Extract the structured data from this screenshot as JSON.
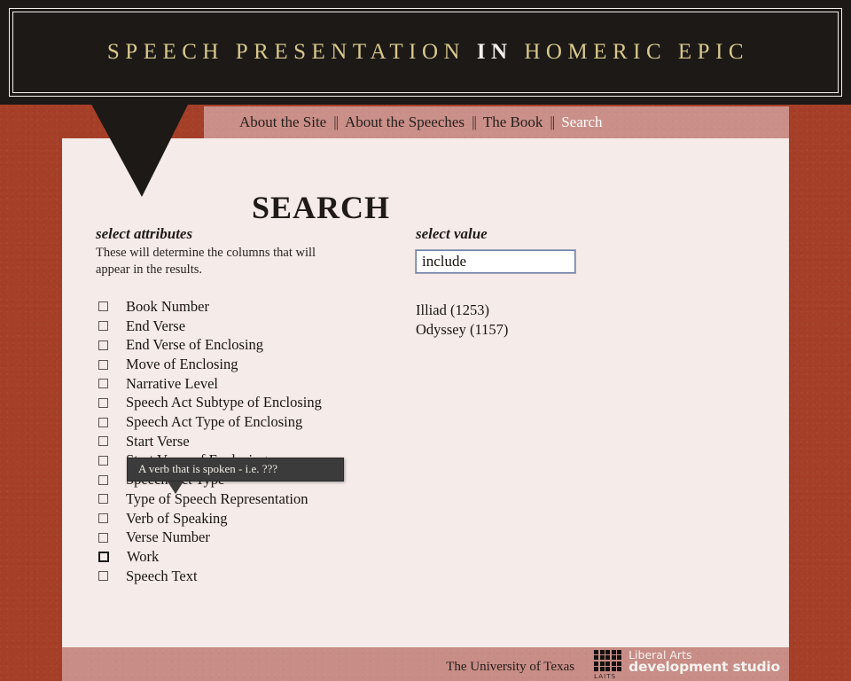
{
  "banner": {
    "title_part1": "SPEECH PRESENTATION",
    "title_highlight": "IN",
    "title_part2": "HOMERIC EPIC",
    "bg_color": "#1c1917",
    "text_color": "#d8c88c",
    "highlight_color": "#f2f0ec"
  },
  "nav": {
    "separator": "||",
    "items": [
      {
        "label": "About the Site",
        "active": false
      },
      {
        "label": "About the Speeches",
        "active": false
      },
      {
        "label": "The Book",
        "active": false
      },
      {
        "label": "Search",
        "active": true
      }
    ],
    "bg_color": "#ca8f88",
    "active_color": "#ffffff"
  },
  "page": {
    "heading": "SEARCH",
    "bg_color": "#f5ebe8",
    "page_bg_color": "#a63f28"
  },
  "attributes_panel": {
    "heading": "select attributes",
    "description": "These will determine the columns that will appear in the results.",
    "items": [
      {
        "label": "Book Number",
        "checked": false,
        "focused": false
      },
      {
        "label": "End Verse",
        "checked": false,
        "focused": false
      },
      {
        "label": "End Verse of Enclosing",
        "checked": false,
        "focused": false
      },
      {
        "label": "Move of Enclosing",
        "checked": false,
        "focused": false
      },
      {
        "label": "Narrative Level",
        "checked": false,
        "focused": false
      },
      {
        "label": "Speech Act Subtype of Enclosing",
        "checked": false,
        "focused": false
      },
      {
        "label": "Speech Act Type of Enclosing",
        "checked": false,
        "focused": false
      },
      {
        "label": "Start Verse",
        "checked": false,
        "focused": false
      },
      {
        "label": "Start Verse of Enclosing",
        "checked": false,
        "focused": false
      },
      {
        "label": "Speech Act Type",
        "checked": false,
        "focused": false
      },
      {
        "label": "Type of Speech Representation",
        "checked": false,
        "focused": false
      },
      {
        "label": "Verb of Speaking",
        "checked": false,
        "focused": false
      },
      {
        "label": "Verse Number",
        "checked": false,
        "focused": false
      },
      {
        "label": "Work",
        "checked": false,
        "focused": true
      },
      {
        "label": "Speech Text",
        "checked": false,
        "focused": false
      }
    ]
  },
  "value_panel": {
    "heading": "select value",
    "input_value": "include",
    "input_placeholder": "include",
    "values": [
      "Illiad (1253)",
      "Odyssey (1157)"
    ]
  },
  "tooltip": {
    "text": "A verb that is spoken - i.e. ???",
    "bg_color": "#3b3b3b",
    "text_color": "#f0ece6"
  },
  "footer": {
    "university": "The University of Texas",
    "logo_line1": "Liberal Arts",
    "logo_line2": "development studio",
    "logo_acronym": "LAITS",
    "bg_color": "#c78d86"
  }
}
